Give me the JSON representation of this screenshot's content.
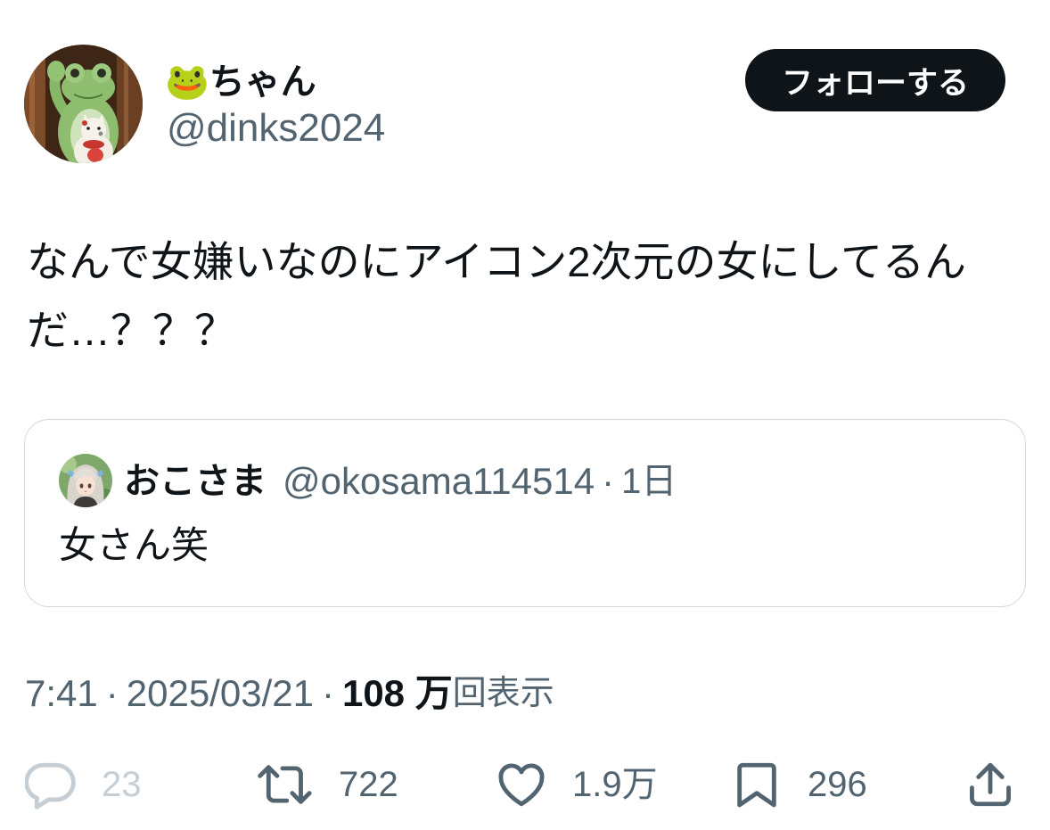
{
  "colors": {
    "text_primary": "#0f1419",
    "text_secondary": "#536471",
    "text_disabled": "#c5ced5",
    "border": "#cfd9de",
    "button_bg": "#0f1419",
    "button_text": "#ffffff",
    "background": "#ffffff"
  },
  "author": {
    "display_name": "🐸ちゃん",
    "handle": "@dinks2024"
  },
  "follow_button": {
    "label": "フォローする"
  },
  "tweet": {
    "text": "なんで女嫌いなのにアイコン2次元の女にしてるんだ…？？？"
  },
  "quote": {
    "display_name": "おこさま",
    "handle": "@okosama114514",
    "separator": "·",
    "time": "1日",
    "text": "女さん笑"
  },
  "meta": {
    "time": "7:41",
    "separator": "·",
    "date": "2025/03/21",
    "views_count": "108 万",
    "views_label": "回表示"
  },
  "actions": [
    {
      "icon": "reply-icon",
      "count": "23",
      "disabled": true
    },
    {
      "icon": "repost-icon",
      "count": "722"
    },
    {
      "icon": "heart-icon",
      "count": "1.9万"
    },
    {
      "icon": "bookmark-icon",
      "count": "296"
    },
    {
      "icon": "share-icon"
    }
  ]
}
